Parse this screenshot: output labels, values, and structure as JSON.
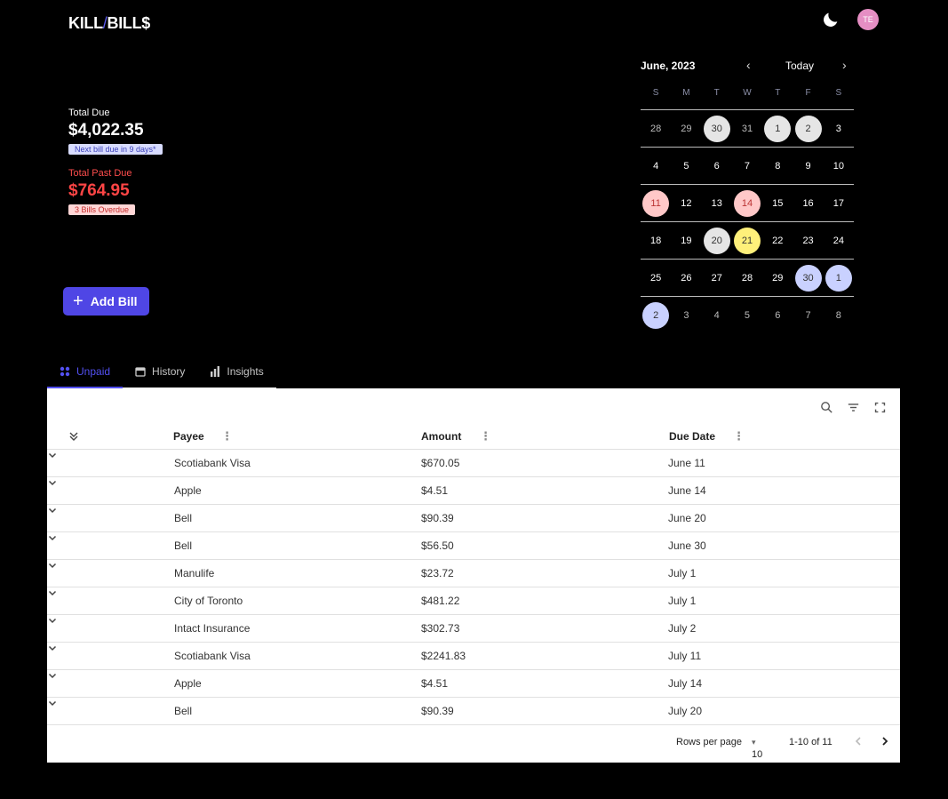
{
  "header": {
    "logo_left": "KILL",
    "logo_slash": "/",
    "logo_right": "BILL$",
    "theme_icon": "moon-icon",
    "avatar_initials": "TE"
  },
  "summary": {
    "total_due_label": "Total Due",
    "total_due_value": "$4,022.35",
    "next_bill_badge": "Next bill due in 9 days*",
    "past_due_label": "Total Past Due",
    "past_due_value": "$764.95",
    "overdue_badge": "3 Bills Overdue"
  },
  "add_bill_label": "Add Bill",
  "calendar": {
    "month_label": "June, 2023",
    "today_label": "Today",
    "weekdays": [
      "S",
      "M",
      "T",
      "W",
      "T",
      "F",
      "S"
    ],
    "weeks": [
      [
        [
          "28",
          "muted"
        ],
        [
          "29",
          "muted"
        ],
        [
          "30",
          "grey"
        ],
        [
          "31",
          "muted"
        ],
        [
          "1",
          "grey"
        ],
        [
          "2",
          "grey"
        ],
        [
          "3",
          ""
        ]
      ],
      [
        [
          "4",
          ""
        ],
        [
          "5",
          ""
        ],
        [
          "6",
          ""
        ],
        [
          "7",
          ""
        ],
        [
          "8",
          ""
        ],
        [
          "9",
          ""
        ],
        [
          "10",
          ""
        ]
      ],
      [
        [
          "11",
          "pink"
        ],
        [
          "12",
          ""
        ],
        [
          "13",
          ""
        ],
        [
          "14",
          "pink"
        ],
        [
          "15",
          ""
        ],
        [
          "16",
          ""
        ],
        [
          "17",
          ""
        ]
      ],
      [
        [
          "18",
          ""
        ],
        [
          "19",
          ""
        ],
        [
          "20",
          "grey"
        ],
        [
          "21",
          "yellow"
        ],
        [
          "22",
          ""
        ],
        [
          "23",
          ""
        ],
        [
          "24",
          ""
        ]
      ],
      [
        [
          "25",
          ""
        ],
        [
          "26",
          ""
        ],
        [
          "27",
          ""
        ],
        [
          "28",
          ""
        ],
        [
          "29",
          ""
        ],
        [
          "30",
          "blue"
        ],
        [
          "1",
          "blue"
        ]
      ],
      [
        [
          "2",
          "blue"
        ],
        [
          "3",
          "muted"
        ],
        [
          "4",
          "muted"
        ],
        [
          "5",
          "muted"
        ],
        [
          "6",
          "muted"
        ],
        [
          "7",
          "muted"
        ],
        [
          "8",
          "muted"
        ]
      ]
    ],
    "colors": {
      "overdue": "#ffc8c8",
      "paid": "#e5e5e5",
      "today": "#fff07a",
      "upcoming": "#c9d1ff"
    }
  },
  "tabs": [
    {
      "label": "Unpaid",
      "icon": "grid-icon",
      "active": true
    },
    {
      "label": "History",
      "icon": "calendar-icon",
      "active": false
    },
    {
      "label": "Insights",
      "icon": "bar-chart-icon",
      "active": false
    }
  ],
  "table": {
    "columns": [
      "Payee",
      "Amount",
      "Due Date"
    ],
    "rows": [
      [
        "Scotiabank Visa",
        "$670.05",
        "June 11"
      ],
      [
        "Apple",
        "$4.51",
        "June 14"
      ],
      [
        "Bell",
        "$90.39",
        "June 20"
      ],
      [
        "Bell",
        "$56.50",
        "June 30"
      ],
      [
        "Manulife",
        "$23.72",
        "July 1"
      ],
      [
        "City of Toronto",
        "$481.22",
        "July 1"
      ],
      [
        "Intact Insurance",
        "$302.73",
        "July 2"
      ],
      [
        "Scotiabank Visa",
        "$2241.83",
        "July 11"
      ],
      [
        "Apple",
        "$4.51",
        "July 14"
      ],
      [
        "Bell",
        "$90.39",
        "July 20"
      ]
    ],
    "rows_per_page_label": "Rows per page",
    "rows_per_page_value": "10",
    "range_label": "1-10 of 11"
  },
  "accent_color": "#4f46e5"
}
